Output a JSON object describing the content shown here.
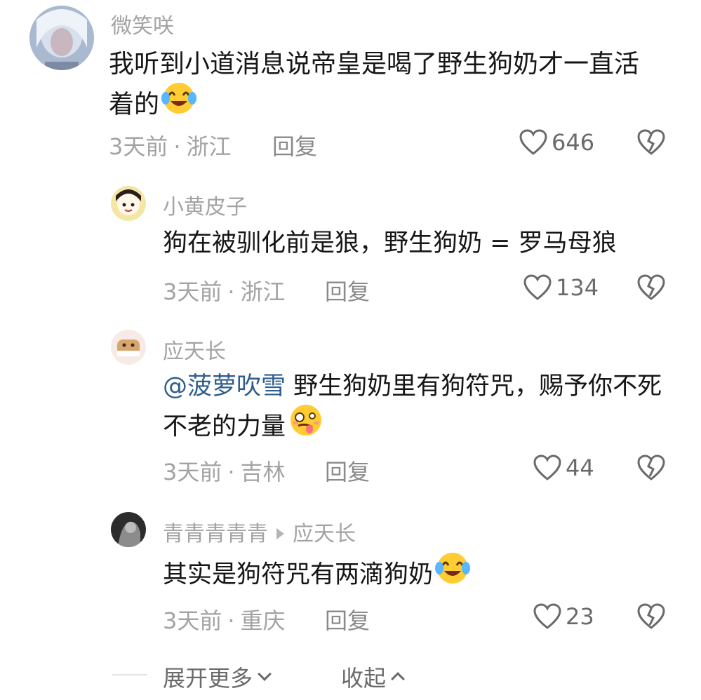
{
  "comments": [
    {
      "username": "微笑咲",
      "text": "我听到小道消息说帝皇是喝了野生狗奶才一直活着的",
      "emoji": "face-with-tears-of-joy",
      "time": "3天前",
      "location": "浙江",
      "reply_label": "回复",
      "likes": "646"
    },
    {
      "username": "小黄皮子",
      "text": "狗在被驯化前是狼，野生狗奶 = 罗马母狼",
      "time": "3天前",
      "location": "浙江",
      "reply_label": "回复",
      "likes": "134"
    },
    {
      "username": "应天长",
      "mention": "@菠萝吹雪",
      "text": " 野生狗奶里有狗符咒，赐予你不死不老的力量",
      "emoji": "woozy-face",
      "time": "3天前",
      "location": "吉林",
      "reply_label": "回复",
      "likes": "44"
    },
    {
      "username": "青青青青青",
      "reply_to": "应天长",
      "text": "其实是狗符咒有两滴狗奶",
      "emoji": "face-with-tears-of-joy",
      "time": "3天前",
      "location": "重庆",
      "reply_label": "回复",
      "likes": "23"
    }
  ],
  "footer": {
    "expand_label": "展开更多",
    "collapse_label": "收起"
  },
  "icons": {
    "like": "heart-outline-icon",
    "dislike": "broken-heart-icon",
    "expand": "chevron-down-icon",
    "collapse": "chevron-up-icon"
  },
  "colors": {
    "mention": "#2f5d8c",
    "secondary_text": "#a3a3a3",
    "primary_text": "#161616"
  }
}
